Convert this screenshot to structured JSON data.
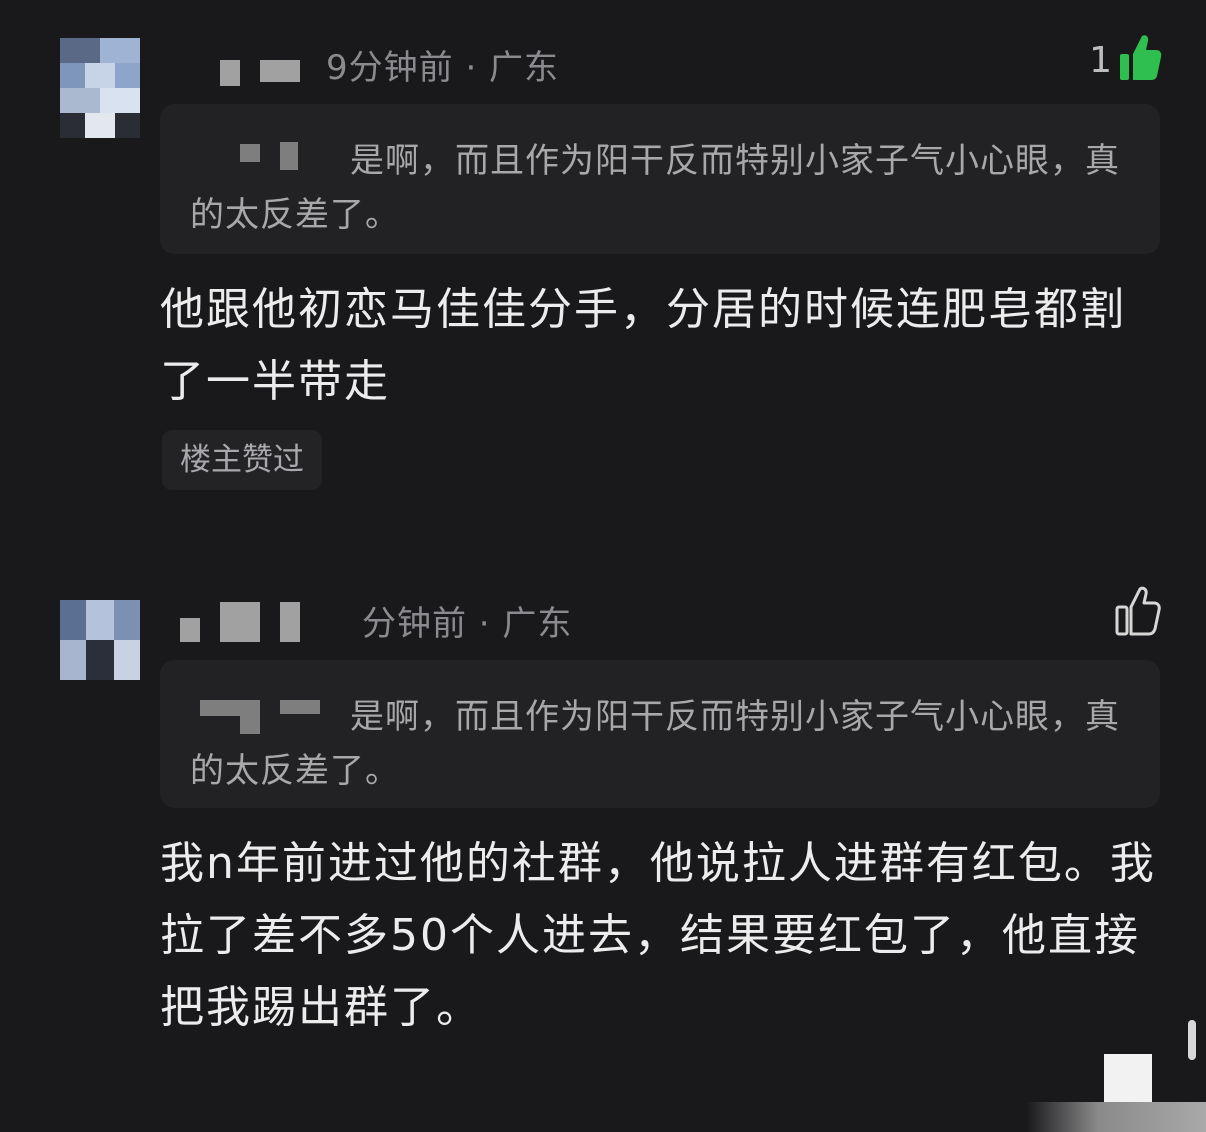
{
  "comments": [
    {
      "meta": "9分钟前 · 广东",
      "like_count": "1",
      "quote_text": "是啊，而且作为阳干反而特别小家子气小心眼，真的太反差了。",
      "body": "他跟他初恋马佳佳分手，分居的时候连肥皂都割了一半带走",
      "badge": "楼主赞过"
    },
    {
      "meta": "分钟前 · 广东",
      "like_count": "",
      "quote_text": "是啊，而且作为阳干反而特别小家子气小心眼，真的太反差了。",
      "body": "我n年前进过他的社群，他说拉人进群有红包。我拉了差不多50个人进去，结果要红包了，他直接把我踢出群了。"
    }
  ],
  "icons": {
    "like_filled": "thumbs-up-filled-icon",
    "like_outline": "thumbs-up-outline-icon"
  },
  "colors": {
    "like_active": "#2fbf4f",
    "background": "#19191b"
  }
}
